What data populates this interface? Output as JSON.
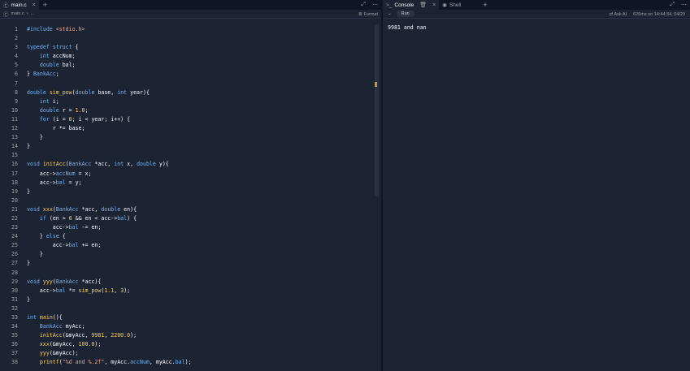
{
  "editor": {
    "tab_label": "main.c",
    "breadcrumb_file": "main.c",
    "breadcrumb_more": "...",
    "format_label": "Format",
    "lines": [
      {
        "n": "1",
        "tokens": [
          [
            "pp",
            "#include "
          ],
          [
            "inc",
            "<stdio.h>"
          ]
        ]
      },
      {
        "n": "2",
        "tokens": []
      },
      {
        "n": "3",
        "tokens": [
          [
            "kw",
            "typedef struct"
          ],
          [
            "id",
            " {"
          ]
        ]
      },
      {
        "n": "4",
        "tokens": [
          [
            "id",
            "    "
          ],
          [
            "ty",
            "int"
          ],
          [
            "id",
            " accNum;"
          ]
        ]
      },
      {
        "n": "5",
        "tokens": [
          [
            "id",
            "    "
          ],
          [
            "ty",
            "double"
          ],
          [
            "id",
            " bal;"
          ]
        ]
      },
      {
        "n": "6",
        "tokens": [
          [
            "id",
            "} "
          ],
          [
            "ty",
            "BankAcc"
          ],
          [
            "id",
            ";"
          ]
        ]
      },
      {
        "n": "7",
        "tokens": []
      },
      {
        "n": "8",
        "tokens": [
          [
            "ty",
            "double"
          ],
          [
            "id",
            " "
          ],
          [
            "fn",
            "sim_pow"
          ],
          [
            "id",
            "("
          ],
          [
            "ty",
            "double"
          ],
          [
            "id",
            " base, "
          ],
          [
            "ty",
            "int"
          ],
          [
            "id",
            " year){"
          ]
        ]
      },
      {
        "n": "9",
        "tokens": [
          [
            "id",
            "    "
          ],
          [
            "ty",
            "int"
          ],
          [
            "id",
            " i;"
          ]
        ]
      },
      {
        "n": "10",
        "tokens": [
          [
            "id",
            "    "
          ],
          [
            "ty",
            "double"
          ],
          [
            "id",
            " r = "
          ],
          [
            "num",
            "1.0"
          ],
          [
            "id",
            ";"
          ]
        ]
      },
      {
        "n": "11",
        "tokens": [
          [
            "id",
            "    "
          ],
          [
            "kw",
            "for"
          ],
          [
            "id",
            " (i = "
          ],
          [
            "num",
            "0"
          ],
          [
            "id",
            "; i < year; i++) {"
          ]
        ]
      },
      {
        "n": "12",
        "tokens": [
          [
            "id",
            "        r *= base;"
          ]
        ]
      },
      {
        "n": "13",
        "tokens": [
          [
            "id",
            "    }"
          ]
        ]
      },
      {
        "n": "14",
        "tokens": [
          [
            "id",
            "}"
          ]
        ]
      },
      {
        "n": "15",
        "tokens": []
      },
      {
        "n": "16",
        "tokens": [
          [
            "ty",
            "void"
          ],
          [
            "id",
            " "
          ],
          [
            "fn",
            "initAcc"
          ],
          [
            "id",
            "("
          ],
          [
            "ty",
            "BankAcc"
          ],
          [
            "id",
            " *acc, "
          ],
          [
            "ty",
            "int"
          ],
          [
            "id",
            " x, "
          ],
          [
            "ty",
            "double"
          ],
          [
            "id",
            " y){"
          ]
        ]
      },
      {
        "n": "17",
        "tokens": [
          [
            "id",
            "    acc->"
          ],
          [
            "ty",
            "accNum"
          ],
          [
            "id",
            " = x;"
          ]
        ]
      },
      {
        "n": "18",
        "tokens": [
          [
            "id",
            "    acc->"
          ],
          [
            "ty",
            "bal"
          ],
          [
            "id",
            " = y;"
          ]
        ]
      },
      {
        "n": "19",
        "tokens": [
          [
            "id",
            "}"
          ]
        ]
      },
      {
        "n": "20",
        "tokens": []
      },
      {
        "n": "21",
        "tokens": [
          [
            "ty",
            "void"
          ],
          [
            "id",
            " "
          ],
          [
            "fn",
            "xxx"
          ],
          [
            "id",
            "("
          ],
          [
            "ty",
            "BankAcc"
          ],
          [
            "id",
            " *acc, "
          ],
          [
            "ty",
            "double"
          ],
          [
            "id",
            " en){"
          ]
        ]
      },
      {
        "n": "22",
        "tokens": [
          [
            "id",
            "    "
          ],
          [
            "kw",
            "if"
          ],
          [
            "id",
            " (en > "
          ],
          [
            "num",
            "0"
          ],
          [
            "id",
            " && en < acc->"
          ],
          [
            "ty",
            "bal"
          ],
          [
            "id",
            ") {"
          ]
        ]
      },
      {
        "n": "23",
        "tokens": [
          [
            "id",
            "        acc->"
          ],
          [
            "ty",
            "bal"
          ],
          [
            "id",
            " -= en;"
          ]
        ]
      },
      {
        "n": "24",
        "tokens": [
          [
            "id",
            "    } "
          ],
          [
            "kw",
            "else"
          ],
          [
            "id",
            " {"
          ]
        ]
      },
      {
        "n": "25",
        "tokens": [
          [
            "id",
            "        acc->"
          ],
          [
            "ty",
            "bal"
          ],
          [
            "id",
            " += en;"
          ]
        ]
      },
      {
        "n": "26",
        "tokens": [
          [
            "id",
            "    }"
          ]
        ]
      },
      {
        "n": "27",
        "tokens": [
          [
            "id",
            "}"
          ]
        ]
      },
      {
        "n": "28",
        "tokens": []
      },
      {
        "n": "29",
        "tokens": [
          [
            "ty",
            "void"
          ],
          [
            "id",
            " "
          ],
          [
            "fn",
            "yyy"
          ],
          [
            "id",
            "("
          ],
          [
            "ty",
            "BankAcc"
          ],
          [
            "id",
            " *acc){"
          ]
        ]
      },
      {
        "n": "30",
        "tokens": [
          [
            "id",
            "    acc->"
          ],
          [
            "ty",
            "bal"
          ],
          [
            "id",
            " *= "
          ],
          [
            "fn",
            "sim_pow"
          ],
          [
            "id",
            "("
          ],
          [
            "num",
            "1.1"
          ],
          [
            "id",
            ", "
          ],
          [
            "num",
            "3"
          ],
          [
            "id",
            ");"
          ]
        ]
      },
      {
        "n": "31",
        "tokens": [
          [
            "id",
            "}"
          ]
        ]
      },
      {
        "n": "32",
        "tokens": []
      },
      {
        "n": "33",
        "tokens": [
          [
            "ty",
            "int"
          ],
          [
            "id",
            " "
          ],
          [
            "fn",
            "main"
          ],
          [
            "id",
            "(){"
          ]
        ]
      },
      {
        "n": "34",
        "tokens": [
          [
            "id",
            "    "
          ],
          [
            "ty",
            "BankAcc"
          ],
          [
            "id",
            " myAcc;"
          ]
        ]
      },
      {
        "n": "35",
        "tokens": [
          [
            "id",
            "    "
          ],
          [
            "fn",
            "initAcc"
          ],
          [
            "id",
            "(&myAcc, "
          ],
          [
            "num",
            "9981"
          ],
          [
            "id",
            ", "
          ],
          [
            "num",
            "2200.0"
          ],
          [
            "id",
            ");"
          ]
        ]
      },
      {
        "n": "36",
        "tokens": [
          [
            "id",
            "    "
          ],
          [
            "fn",
            "xxx"
          ],
          [
            "id",
            "(&myAcc, "
          ],
          [
            "num",
            "100.0"
          ],
          [
            "id",
            ");"
          ]
        ]
      },
      {
        "n": "37",
        "tokens": [
          [
            "id",
            "    "
          ],
          [
            "fn",
            "yyy"
          ],
          [
            "id",
            "(&myAcc);"
          ]
        ]
      },
      {
        "n": "38",
        "tokens": [
          [
            "id",
            "    "
          ],
          [
            "fn",
            "printf"
          ],
          [
            "id",
            "("
          ],
          [
            "str",
            "\"%d and %.2f\""
          ],
          [
            "id",
            ", myAcc."
          ],
          [
            "ty",
            "accNum"
          ],
          [
            "id",
            ", myAcc."
          ],
          [
            "ty",
            "bal"
          ],
          [
            "id",
            ");"
          ]
        ]
      }
    ]
  },
  "console": {
    "tab_console": "Console",
    "tab_shell": "Shell",
    "run_label": "Run",
    "ask_ai": "Ask AI",
    "timing": "626ms on 14:44:34, 04/29",
    "output": "9981 and nan"
  },
  "colors": {
    "background": "#1c2333",
    "keyword": "#6bb5ff",
    "function": "#ffcf50",
    "string": "#ff9f7a"
  }
}
